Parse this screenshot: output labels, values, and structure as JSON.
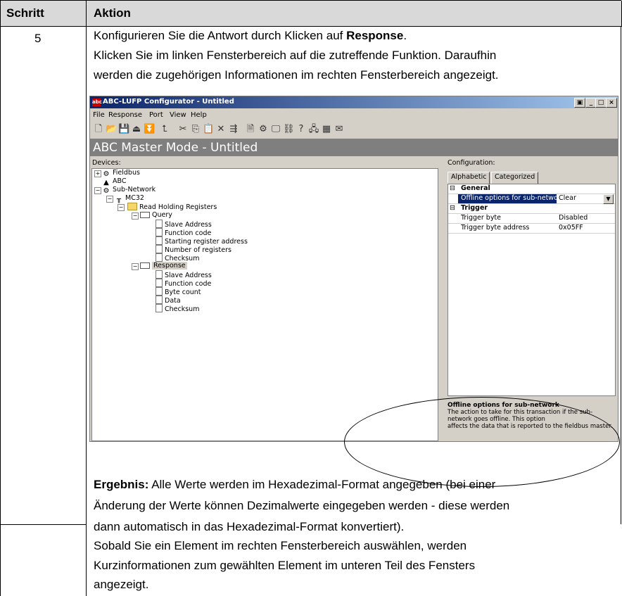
{
  "table": {
    "header_step": "Schritt",
    "header_action": "Aktion",
    "step_number": "5",
    "intro_line1_pre": "Konfigurieren Sie die Antwort durch Klicken auf ",
    "intro_line1_bold": "Response",
    "intro_line1_post": ".",
    "intro_line2": "Klicken Sie im linken Fensterbereich auf die zutreffende Funktion. Daraufhin",
    "intro_line3": "werden die zugehörigen Informationen im rechten Fensterbereich angezeigt.",
    "result_label": "Ergebnis:",
    "result_line1": " Alle Werte werden im Hexadezimal-Format angegeben (bei einer",
    "result_line2": "Änderung der Werte können Dezimalwerte eingegeben werden - diese werden",
    "result_line3": "dann automatisch in das Hexadezimal-Format konvertiert).",
    "result_line4": "Sobald Sie ein Element im rechten Fensterbereich auswählen, werden",
    "result_line5": "Kurzinformationen zum gewählten Element im unteren Teil des Fensters",
    "result_line6": "angezeigt."
  },
  "window": {
    "title": "ABC-LUFP Configurator - Untitled",
    "icon_text": "abc",
    "menu": [
      "File",
      "Response",
      "Port",
      "View",
      "Help"
    ],
    "banner": "ABC Master Mode - Untitled",
    "devices_label": "Devices:",
    "config_label": "Configuration:",
    "tabs": [
      "Alphabetic",
      "Categorized"
    ],
    "tree": [
      "Fieldbus",
      "ABC",
      "Sub-Network",
      "MC32",
      "Read Holding Registers",
      "Query",
      "Slave Address",
      "Function code",
      "Starting register address",
      "Number of registers",
      "Checksum",
      "Response",
      "Slave Address",
      "Function code",
      "Byte count",
      "Data",
      "Checksum"
    ],
    "grid": {
      "general_header": "General",
      "offline_key": "Offline options for sub-network",
      "offline_value": "Clear",
      "trigger_header": "Trigger",
      "trigger_byte_key": "Trigger byte",
      "trigger_byte_value": "Disabled",
      "trigger_addr_key": "Trigger byte address",
      "trigger_addr_value": "0x05FF"
    },
    "help_title": "Offline options for sub-network",
    "help_line1": "The action to take for this transaction if the sub-network goes offline. This option",
    "help_line2": "affects the data that is reported to the fieldbus master."
  },
  "colors": {
    "titlebar": "#0a246a",
    "banner": "#7f7f7f",
    "selection": "#0a246a"
  }
}
